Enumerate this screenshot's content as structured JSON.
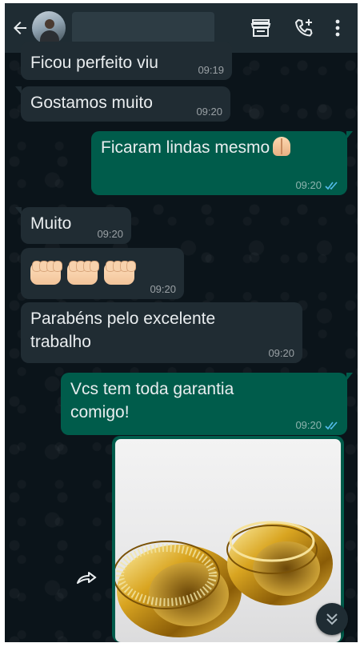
{
  "header": {
    "contact_name": "",
    "icons": [
      "back-arrow-icon",
      "storefront-icon",
      "add-call-icon",
      "more-vert-icon"
    ]
  },
  "messages": [
    {
      "direction": "in",
      "text": "Ficou perfeito viu",
      "time": "09:19"
    },
    {
      "direction": "in",
      "text": "Gostamos muito",
      "time": "09:20"
    },
    {
      "direction": "out",
      "text": "Ficaram lindas mesmo",
      "emoji": "folded-hands",
      "time": "09:20",
      "status": "read"
    },
    {
      "direction": "in",
      "text": "Muito",
      "time": "09:20"
    },
    {
      "direction": "in",
      "emoji": "oncoming-fist x3",
      "time": "09:20"
    },
    {
      "direction": "in",
      "text": "Parabéns pelo excelente trabalho",
      "time": "09:20"
    },
    {
      "direction": "out",
      "text": "Vcs tem toda garantia comigo!",
      "time": "09:20",
      "status": "read"
    },
    {
      "direction": "out",
      "type": "image",
      "image_subject": "two-gold-rings"
    }
  ],
  "colors": {
    "header_bg": "#1f2c33",
    "chat_bg": "#0b141a",
    "incoming_bubble": "#202c33",
    "outgoing_bubble": "#005c4b",
    "read_ticks": "#53bdeb"
  }
}
